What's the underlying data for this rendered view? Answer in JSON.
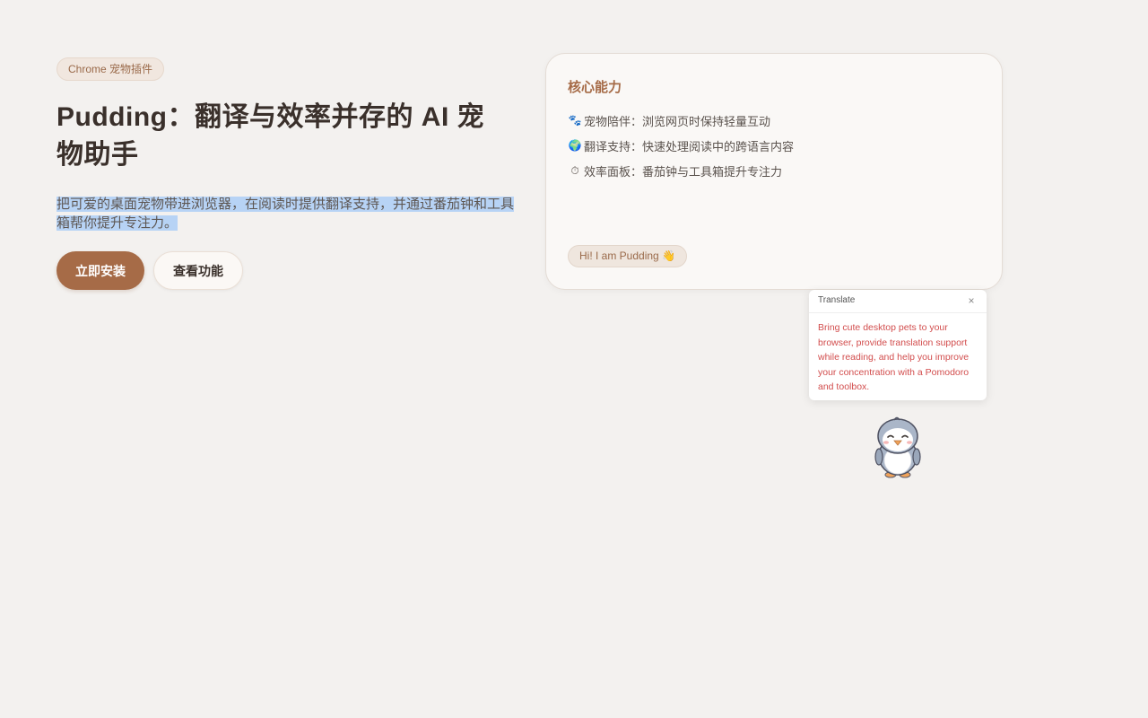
{
  "hero": {
    "tag": "Chrome 宠物插件",
    "title": "Pudding：翻译与效率并存的 AI 宠物助手",
    "description": "把可爱的桌面宠物带进浏览器，在阅读时提供翻译支持，并通过番茄钟和工具箱帮你提升专注力。",
    "primary_button": "立即安装",
    "secondary_button": "查看功能"
  },
  "card": {
    "title": "核心能力",
    "features": [
      {
        "icon": "🐾",
        "text": "宠物陪伴：浏览网页时保持轻量互动"
      },
      {
        "icon": "🌍",
        "text": "翻译支持：快速处理阅读中的跨语言内容"
      },
      {
        "icon": "⏱",
        "text": "效率面板：番茄钟与工具箱提升专注力"
      }
    ],
    "greeting": "Hi! I am Pudding 👋"
  },
  "translate": {
    "title": "Translate",
    "close": "×",
    "text": "Bring cute desktop pets to your browser, provide translation support while reading, and help you improve your concentration with a Pomodoro and toolbox."
  },
  "icons": {
    "feature_icons": [
      "paw-icon",
      "globe-icon",
      "stopwatch-icon"
    ],
    "pet": "penguin-pet-icon"
  },
  "colors": {
    "accent": "#a66b47",
    "page_bg": "#f3f1ef",
    "translation_text": "#d24d4d",
    "selection": "#b7d3f5"
  }
}
